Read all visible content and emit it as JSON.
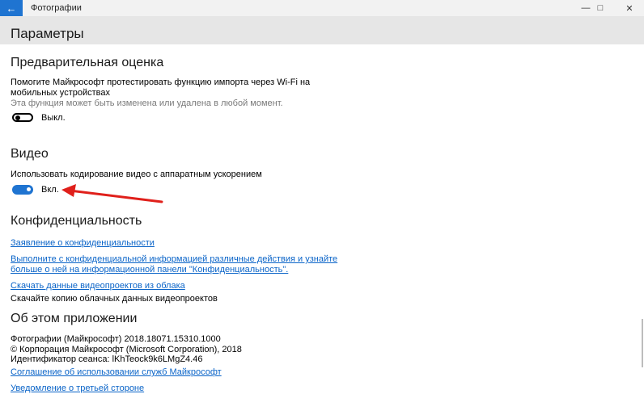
{
  "window": {
    "app_title": "Фотографии",
    "back_icon": "back-arrow-icon",
    "controls": {
      "minimize": "—",
      "maximize": "□",
      "close": "✕"
    }
  },
  "header": {
    "title": "Параметры"
  },
  "preview": {
    "title": "Предварительная оценка",
    "description_line1": "Помогите Майкрософт протестировать функцию импорта через Wi-Fi на",
    "description_line2": "мобильных устройствах",
    "note": "Эта функция может быть изменена или удалена в любой момент.",
    "toggle_label": "Выкл.",
    "toggle_state": false
  },
  "video": {
    "title": "Видео",
    "description": "Использовать кодирование видео с аппаратным ускорением",
    "toggle_label": "Вкл.",
    "toggle_state": true,
    "annotation_color": "#e0201b"
  },
  "privacy": {
    "title": "Конфиденциальность",
    "link_statement": "Заявление о конфиденциальности",
    "link_actions_line1": "Выполните с конфиденциальной информацией различные действия и узнайте",
    "link_actions_line2": "больше о ней на информационной панели \"Конфиденциальность\".",
    "link_download": "Скачать данные видеопроектов из облака",
    "download_note": "Скачайте копию облачных данных видеопроектов"
  },
  "about": {
    "title": "Об этом приложении",
    "version": "Фотографии (Майкрософт) 2018.18071.15310.1000",
    "copyright": "© Корпорация Майкрософт (Microsoft Corporation), 2018",
    "session": "Идентификатор сеанса: lKhTeock9k6LMgZ4.46",
    "link_services": "Соглашение об использовании служб Майкрософт",
    "link_third_party": "Уведомление о третьей стороне"
  },
  "colors": {
    "accent": "#1f74d1",
    "link": "#0a64c8",
    "header_bg": "#e6e6e6"
  }
}
